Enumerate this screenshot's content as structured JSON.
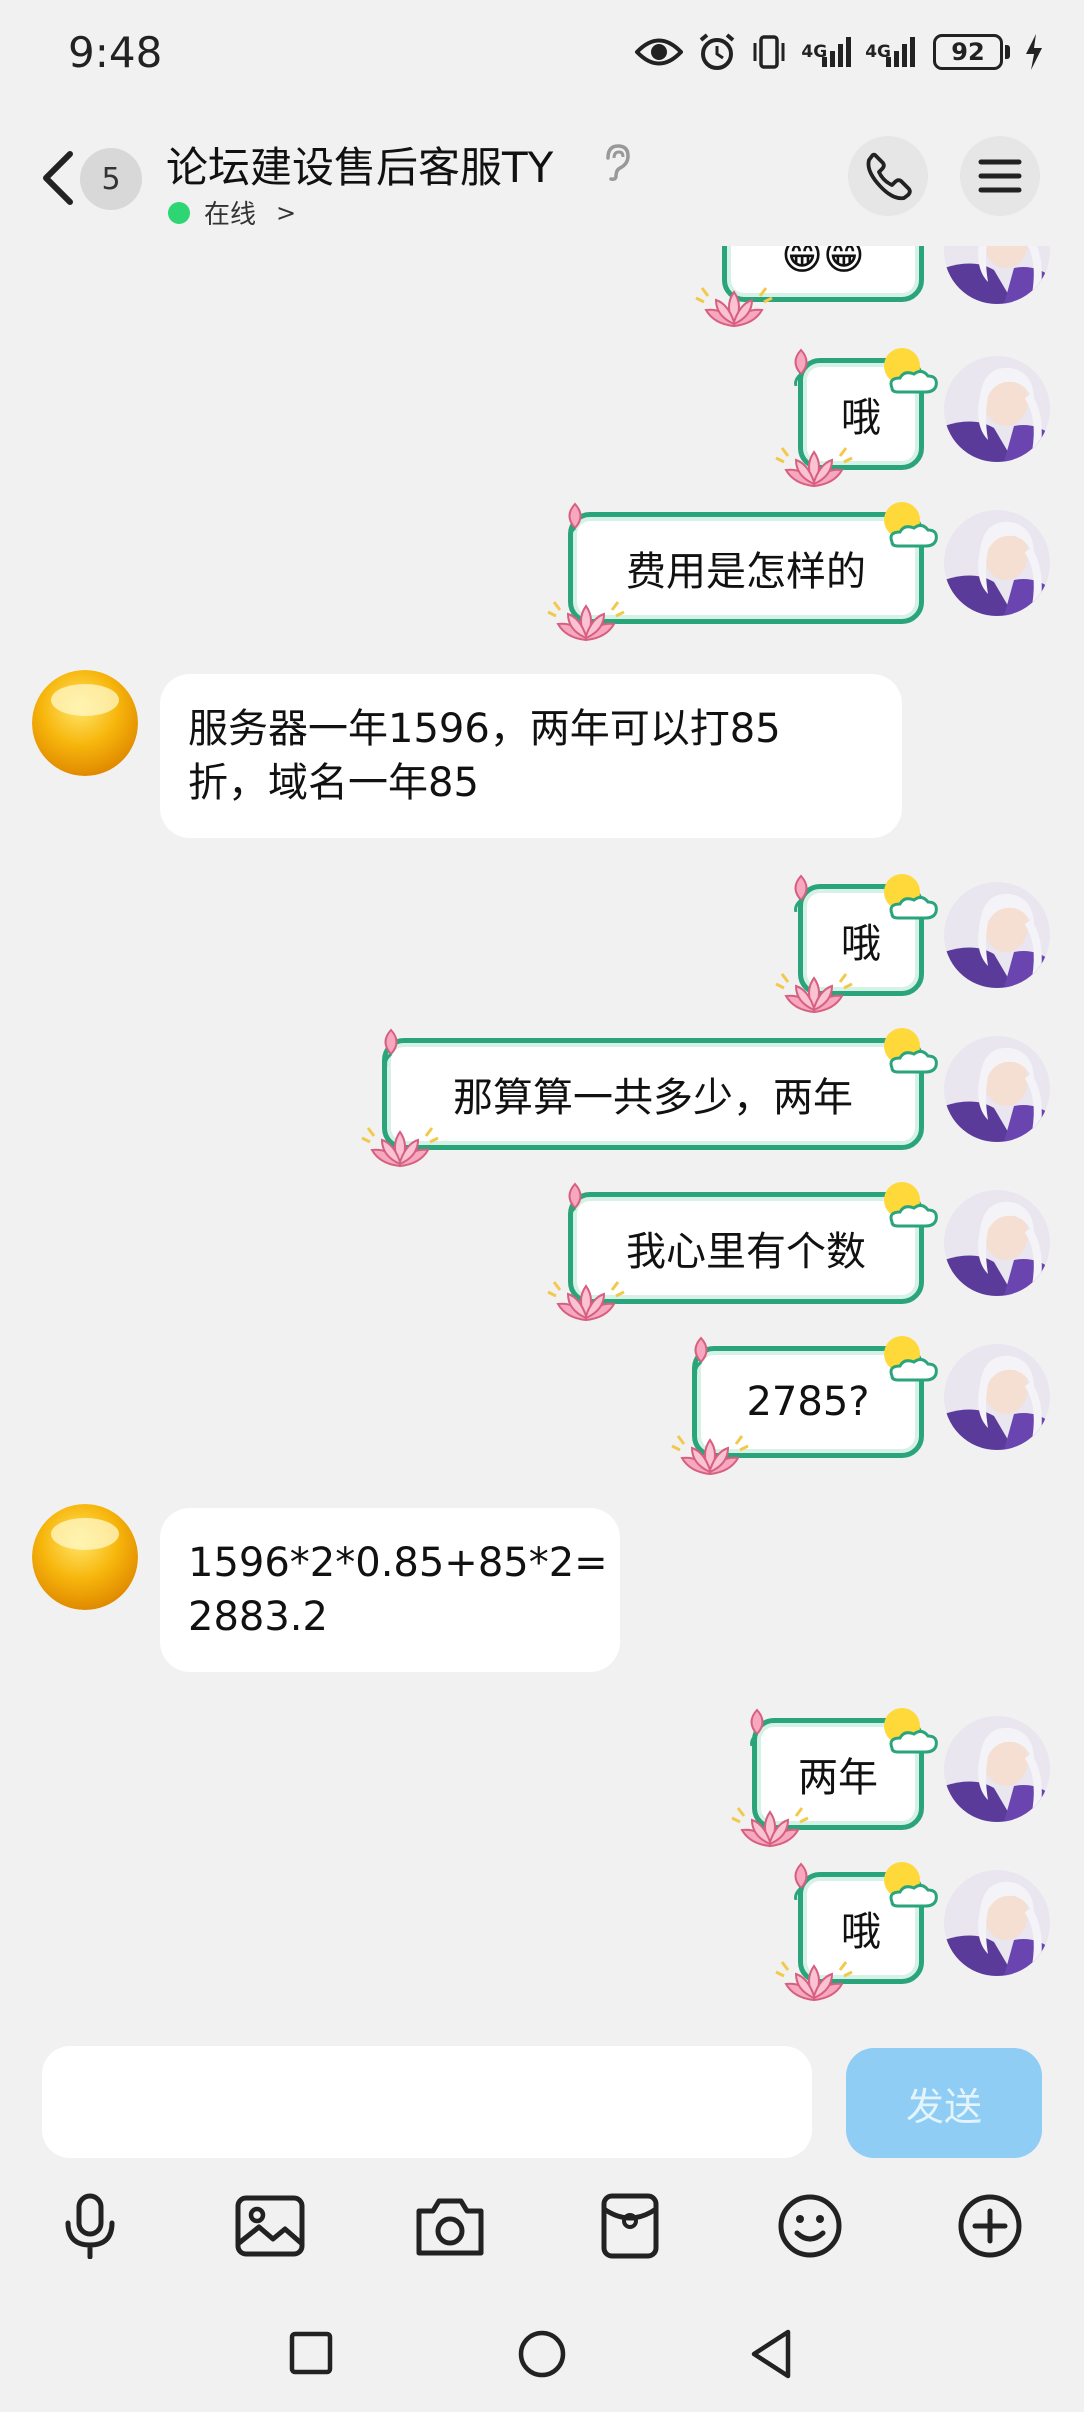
{
  "status_bar": {
    "time": "9:48",
    "network_1": "4G",
    "network_2": "4G",
    "battery": "92"
  },
  "header": {
    "unread_count": "5",
    "title": "论坛建设售后客服TY",
    "status": "在线",
    "status_chevron": ">"
  },
  "messages": [
    {
      "side": "me",
      "text": "😁😁"
    },
    {
      "side": "me",
      "text": "哦"
    },
    {
      "side": "me",
      "text": "费用是怎样的"
    },
    {
      "side": "other",
      "lines": [
        "服务器一年1596，两年可以打85",
        "折，域名一年85"
      ]
    },
    {
      "side": "me",
      "text": "哦"
    },
    {
      "side": "me",
      "text": "那算算一共多少，两年"
    },
    {
      "side": "me",
      "text": "我心里有个数"
    },
    {
      "side": "me",
      "text": "2785?"
    },
    {
      "side": "other",
      "lines": [
        "1596*2*0.85+85*2=",
        "2883.2"
      ]
    },
    {
      "side": "me",
      "text": "两年"
    },
    {
      "side": "me",
      "text": "哦"
    }
  ],
  "input": {
    "value": "",
    "send_label": "发送"
  },
  "toolbar_icons": [
    "microphone-icon",
    "image-icon",
    "camera-icon",
    "red-packet-icon",
    "emoji-icon",
    "plus-icon"
  ],
  "colors": {
    "bubble_border": "#2aa47a",
    "send_button": "#8fcdf5",
    "online_dot": "#2ed573",
    "background": "#f1f1f1"
  }
}
